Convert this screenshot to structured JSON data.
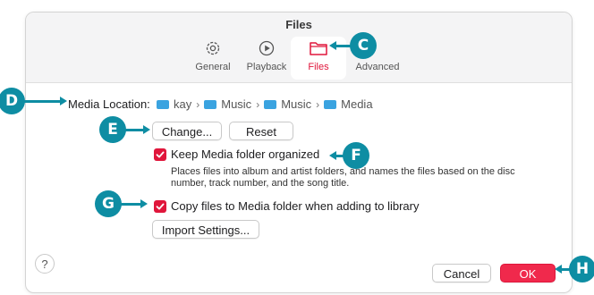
{
  "window": {
    "title": "Files"
  },
  "tabs": [
    {
      "label": "General",
      "icon": "gear-icon",
      "selected": false
    },
    {
      "label": "Playback",
      "icon": "play-circle-icon",
      "selected": false
    },
    {
      "label": "Files",
      "icon": "folder-icon",
      "selected": true
    },
    {
      "label": "Advanced",
      "icon": "",
      "selected": false
    }
  ],
  "media_location": {
    "label": "Media Location:",
    "path": [
      "kay",
      "Music",
      "Music",
      "Media"
    ]
  },
  "buttons": {
    "change": "Change...",
    "reset": "Reset",
    "import_settings": "Import Settings...",
    "cancel": "Cancel",
    "ok": "OK",
    "help": "?"
  },
  "options": {
    "keep_organized": {
      "label": "Keep Media folder organized",
      "checked": true,
      "description_line1": "Places files into album and artist folders, and names the files based on the disc",
      "description_line2": "number, track number, and the song title."
    },
    "copy_files": {
      "label": "Copy files to Media folder when adding to library",
      "checked": true
    }
  },
  "callouts": [
    "C",
    "D",
    "E",
    "F",
    "G",
    "H"
  ],
  "colors": {
    "accent": "#e0163b",
    "callout": "#0e8da3",
    "folder": "#3aa3e0"
  }
}
